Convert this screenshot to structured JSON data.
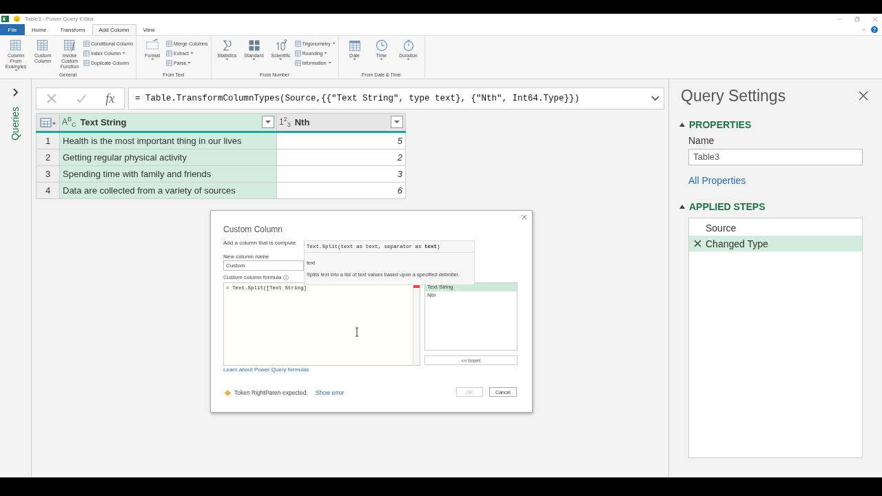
{
  "window": {
    "title": "Table3 - Power Query Editor"
  },
  "ribbon_tabs": [
    {
      "label": "File",
      "kind": "file",
      "selected": false
    },
    {
      "label": "Home",
      "kind": "tab",
      "selected": false
    },
    {
      "label": "Transform",
      "kind": "tab",
      "selected": false
    },
    {
      "label": "Add Column",
      "kind": "tab",
      "selected": true
    },
    {
      "label": "View",
      "kind": "tab",
      "selected": false
    }
  ],
  "ribbon_groups": [
    {
      "label": "General",
      "big": [
        {
          "label": "Column From Examples",
          "dropdown": true
        },
        {
          "label": "Custom Column",
          "dropdown": false
        },
        {
          "label": "Invoke Custom Function",
          "dropdown": false
        }
      ],
      "small": [
        {
          "label": "Conditional Column",
          "dropdown": false
        },
        {
          "label": "Index Column",
          "dropdown": true
        },
        {
          "label": "Duplicate Column",
          "dropdown": false
        }
      ]
    },
    {
      "label": "From Text",
      "big": [
        {
          "label": "Format",
          "dropdown": true
        }
      ],
      "small": [
        {
          "label": "Merge Columns",
          "dropdown": false
        },
        {
          "label": "Extract",
          "dropdown": true
        },
        {
          "label": "Parse",
          "dropdown": true
        }
      ]
    },
    {
      "label": "From Number",
      "big": [
        {
          "label": "Statistics",
          "dropdown": true
        },
        {
          "label": "Standard",
          "dropdown": true
        },
        {
          "label": "Scientific",
          "dropdown": true
        }
      ],
      "small": [
        {
          "label": "Trigonometry",
          "dropdown": true
        },
        {
          "label": "Rounding",
          "dropdown": true
        },
        {
          "label": "Information",
          "dropdown": true
        }
      ]
    },
    {
      "label": "From Date & Time",
      "big": [
        {
          "label": "Date",
          "dropdown": true
        },
        {
          "label": "Time",
          "dropdown": true
        },
        {
          "label": "Duration",
          "dropdown": true
        }
      ]
    }
  ],
  "queries_pane": {
    "label": "Queries"
  },
  "formula_bar": {
    "fx_button": "fx",
    "formula": "= Table.TransformColumnTypes(Source,{{\"Text String\", type text}, {\"Nth\", Int64.Type}})"
  },
  "table": {
    "columns": [
      {
        "name": "Text String",
        "type_label": "A$^{B}$$_{C}$"
      },
      {
        "name": "Nth",
        "type_label": "1$^{2}$$_{3}$"
      }
    ],
    "rows": [
      {
        "index": "1",
        "cells": [
          "Health is the most important thing in our lives",
          "5"
        ]
      },
      {
        "index": "2",
        "cells": [
          "Getting regular physical activity",
          "2"
        ]
      },
      {
        "index": "3",
        "cells": [
          "Spending time with family and friends",
          "3"
        ]
      },
      {
        "index": "4",
        "cells": [
          "Data are collected from a variety of sources",
          "6"
        ]
      }
    ]
  },
  "dialog": {
    "title": "Custom Column",
    "description": "Add a column that is compute",
    "name_label": "New column name",
    "name_value": "Custom",
    "formula_label": "Custom column formula",
    "formula": "= Text.Split([Text String]",
    "available_columns": [
      {
        "label": "Text String",
        "selected": true
      },
      {
        "label": "Nth",
        "selected": false
      }
    ],
    "insert_button": "<< Insert",
    "learn_link": "Learn about Power Query formulas",
    "error": "Token RightParen expected.",
    "show_error": "Show error",
    "ok_button": "OK",
    "ok_disabled": true,
    "cancel_button": "Cancel",
    "tooltip": {
      "signature": "Text.Split(text as text, separator as **text**)",
      "parameter": "text",
      "description": "Splits text into a list of text values based upon a specified delimiter."
    }
  },
  "query_settings": {
    "title": "Query Settings",
    "properties_heading": "PROPERTIES",
    "name_label": "Name",
    "name_value": "Table3",
    "all_properties": "All Properties",
    "steps_heading": "APPLIED STEPS",
    "steps": [
      {
        "label": "Source",
        "selected": false,
        "has_delete": false
      },
      {
        "label": "Changed Type",
        "selected": true,
        "has_delete": true
      }
    ]
  }
}
